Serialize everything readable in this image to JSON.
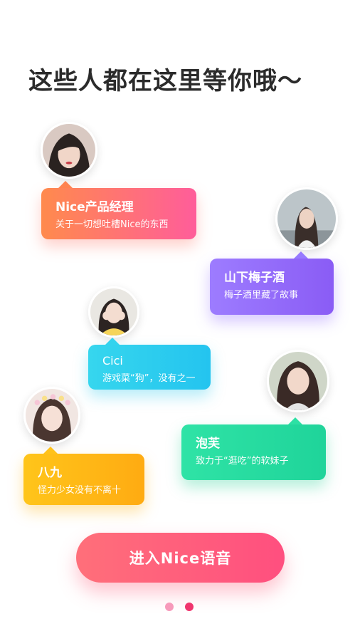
{
  "header": {
    "title": "这些人都在这里等你哦～"
  },
  "users": [
    {
      "name": "Nice产品经理",
      "desc": "关于一切想吐槽Nice的东西",
      "avatar_icon": "user-avatar-icon"
    },
    {
      "name": "山下梅子酒",
      "desc": "梅子酒里藏了故事",
      "avatar_icon": "user-avatar-icon"
    },
    {
      "name": "Cici",
      "desc": "游戏菜“狗”，没有之一",
      "avatar_icon": "user-avatar-icon"
    },
    {
      "name": "泡芙",
      "desc": "致力于“逛吃”的软妹子",
      "avatar_icon": "user-avatar-icon"
    },
    {
      "name": "八九",
      "desc": "怪力少女没有不离十",
      "avatar_icon": "user-avatar-icon"
    }
  ],
  "cta": {
    "label": "进入Nice语音"
  },
  "pagination": {
    "count": 2,
    "active_index": 1
  },
  "colors": {
    "orange_pink": "#ff7a6e",
    "purple": "#8f6cf8",
    "cyan": "#2fcdee",
    "green": "#26da9f",
    "yellow": "#ffbb16",
    "cta": "#ff5e7d"
  }
}
